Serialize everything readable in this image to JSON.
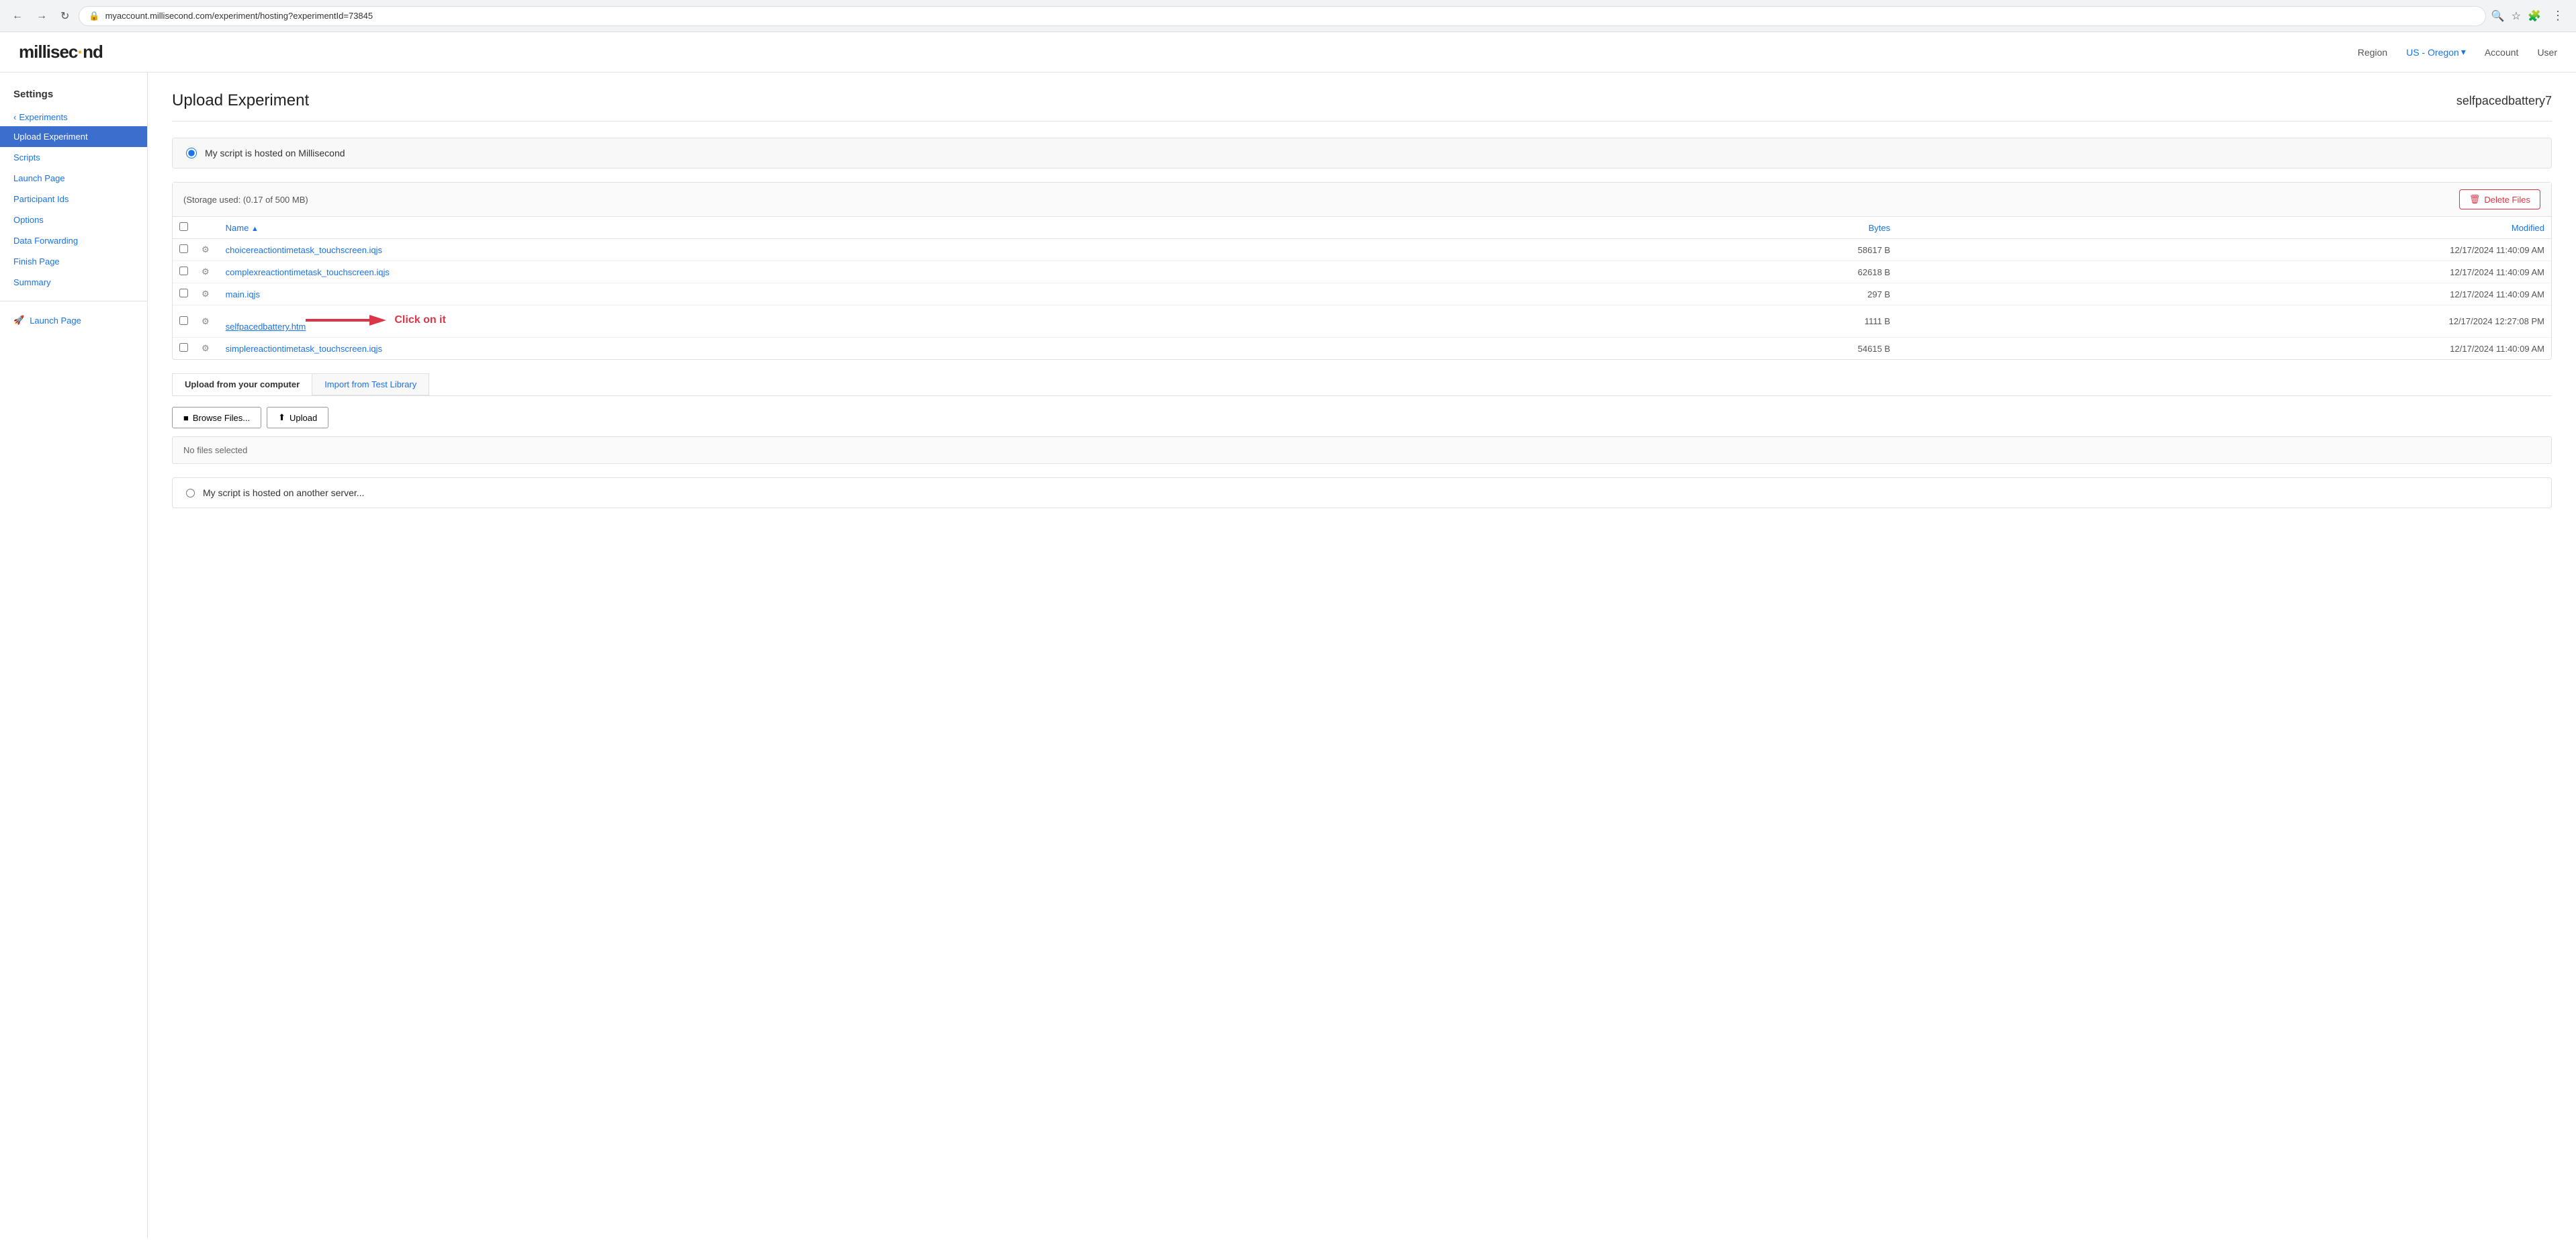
{
  "browser": {
    "back_btn": "←",
    "forward_btn": "→",
    "refresh_btn": "↻",
    "url": "myaccount.millisecond.com/experiment/hosting?experimentId=73845",
    "search_icon": "🔍",
    "bookmark_icon": "☆",
    "extensions_icon": "🧩",
    "menu_icon": "⋮"
  },
  "header": {
    "logo_text_1": "millisec",
    "logo_dot": "·",
    "logo_text_2": "nd",
    "region_label": "Region",
    "region_value": "US - Oregon",
    "account_label": "Account",
    "user_label": "User"
  },
  "sidebar": {
    "section_title": "Settings",
    "back_label": "Experiments",
    "items": [
      {
        "id": "upload-experiment",
        "label": "Upload Experiment",
        "active": true
      },
      {
        "id": "scripts",
        "label": "Scripts",
        "active": false
      },
      {
        "id": "launch-page",
        "label": "Launch Page",
        "active": false
      },
      {
        "id": "participant-ids",
        "label": "Participant Ids",
        "active": false
      },
      {
        "id": "options",
        "label": "Options",
        "active": false
      },
      {
        "id": "data-forwarding",
        "label": "Data Forwarding",
        "active": false
      },
      {
        "id": "finish-page",
        "label": "Finish Page",
        "active": false
      },
      {
        "id": "summary",
        "label": "Summary",
        "active": false
      }
    ],
    "launch_page_label": "Launch Page",
    "rocket_icon": "🚀"
  },
  "main": {
    "page_title": "Upload Experiment",
    "experiment_name": "selfpacedbattery7",
    "radio_option_1_label": "My script is hosted on Millisecond",
    "storage_info": "(Storage used: (0.17 of 500 MB)",
    "delete_files_label": "Delete Files",
    "table": {
      "col_checkbox": "",
      "col_name": "Name",
      "col_sort_arrow": "▲",
      "col_bytes": "Bytes",
      "col_modified": "Modified",
      "rows": [
        {
          "name": "choicereactiontimetask_touchscreen.iqjs",
          "is_link": false,
          "bytes": "58617 B",
          "modified": "12/17/2024 11:40:09 AM"
        },
        {
          "name": "complexreactiontimetask_touchscreen.iqjs",
          "is_link": false,
          "bytes": "62618 B",
          "modified": "12/17/2024 11:40:09 AM"
        },
        {
          "name": "main.iqjs",
          "is_link": false,
          "bytes": "297 B",
          "modified": "12/17/2024 11:40:09 AM"
        },
        {
          "name": "selfpacedbattery.htm",
          "is_link": true,
          "bytes": "1111 B",
          "modified": "12/17/2024 12:27:08 PM",
          "annotated": true
        },
        {
          "name": "simplereactiontimetask_touchscreen.iqjs",
          "is_link": false,
          "bytes": "54615 B",
          "modified": "12/17/2024 11:40:09 AM"
        }
      ]
    },
    "upload_tab_1": "Upload from your computer",
    "upload_tab_2": "Import from Test Library",
    "browse_files_label": "Browse Files...",
    "upload_label": "Upload",
    "no_files_label": "No files selected",
    "click_annotation": "Click on it",
    "radio_option_2_label": "My script is hosted on another server..."
  }
}
